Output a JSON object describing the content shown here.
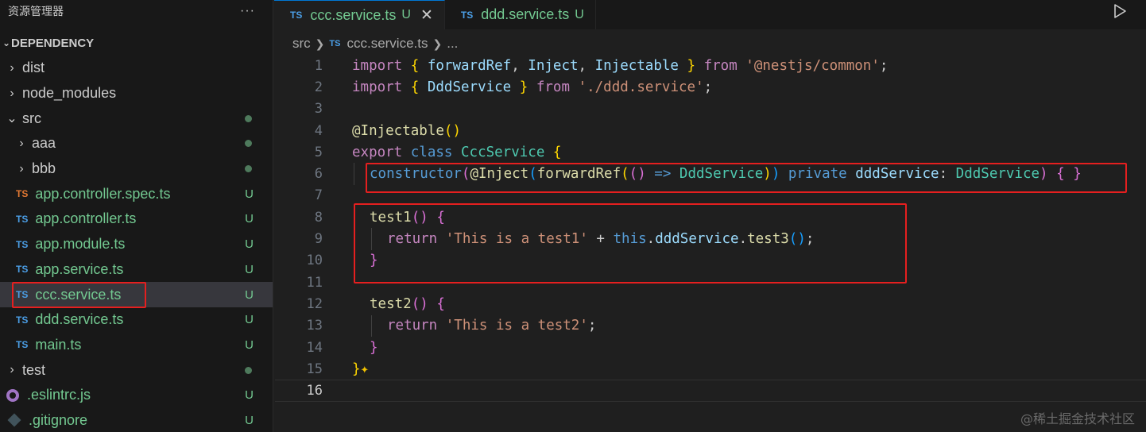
{
  "sidebar": {
    "title": "资源管理器",
    "more": "···",
    "section": "DEPENDENCY",
    "items": [
      {
        "name": "dist",
        "kind": "folder",
        "expanded": false,
        "level": 0,
        "status": ""
      },
      {
        "name": "node_modules",
        "kind": "folder",
        "expanded": false,
        "level": 0,
        "status": ""
      },
      {
        "name": "src",
        "kind": "folder",
        "expanded": true,
        "level": 0,
        "status": "dot"
      },
      {
        "name": "aaa",
        "kind": "folder",
        "expanded": false,
        "level": 1,
        "status": "dot"
      },
      {
        "name": "bbb",
        "kind": "folder",
        "expanded": false,
        "level": 1,
        "status": "dot"
      },
      {
        "name": "app.controller.spec.ts",
        "kind": "ts-spec",
        "level": 1,
        "status": "U"
      },
      {
        "name": "app.controller.ts",
        "kind": "ts",
        "level": 1,
        "status": "U"
      },
      {
        "name": "app.module.ts",
        "kind": "ts",
        "level": 1,
        "status": "U"
      },
      {
        "name": "app.service.ts",
        "kind": "ts",
        "level": 1,
        "status": "U"
      },
      {
        "name": "ccc.service.ts",
        "kind": "ts",
        "level": 1,
        "status": "U",
        "selected": true
      },
      {
        "name": "ddd.service.ts",
        "kind": "ts",
        "level": 1,
        "status": "U"
      },
      {
        "name": "main.ts",
        "kind": "ts",
        "level": 1,
        "status": "U"
      },
      {
        "name": "test",
        "kind": "folder",
        "expanded": false,
        "level": 0,
        "status": "dot"
      },
      {
        "name": ".eslintrc.js",
        "kind": "eslint",
        "level": 0,
        "status": "U"
      },
      {
        "name": ".gitignore",
        "kind": "git",
        "level": 0,
        "status": "U"
      }
    ]
  },
  "tabs": [
    {
      "icon": "TS",
      "label": "ccc.service.ts",
      "status": "U",
      "active": true,
      "close": "✕"
    },
    {
      "icon": "TS",
      "label": "ddd.service.ts",
      "status": "U",
      "active": false
    }
  ],
  "breadcrumb": {
    "folder": "src",
    "icon": "TS",
    "file": "ccc.service.ts",
    "tail": "..."
  },
  "code": {
    "current_line": 16,
    "lines": [
      "1",
      "2",
      "3",
      "4",
      "5",
      "6",
      "7",
      "8",
      "9",
      "10",
      "11",
      "12",
      "13",
      "14",
      "15",
      "16"
    ]
  },
  "icons": {
    "run": "play-icon",
    "ts": "typescript-icon"
  },
  "colors": {
    "highlight_box": "#e51f1f",
    "untracked": "#73c991"
  },
  "watermark": "@稀土掘金技术社区"
}
